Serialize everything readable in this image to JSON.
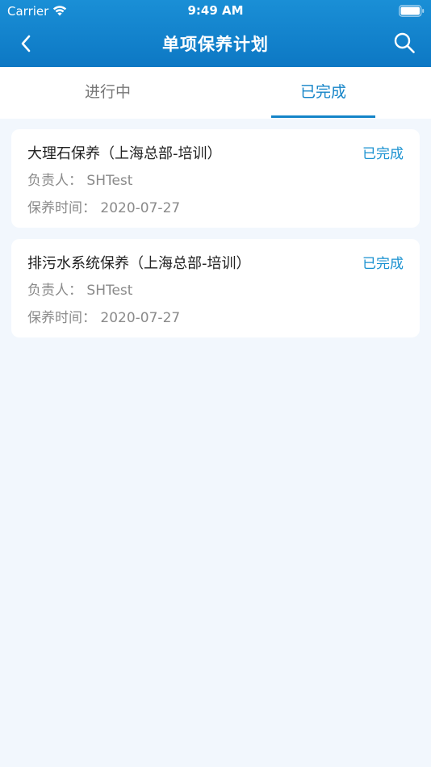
{
  "status_bar": {
    "carrier": "Carrier",
    "time": "9:49 AM",
    "wifi_icon": "wifi-icon",
    "battery_icon": "battery-icon"
  },
  "nav": {
    "title": "单项保养计划",
    "back_icon": "chevron-left-icon",
    "search_icon": "search-icon"
  },
  "tabs": [
    {
      "label": "进行中",
      "selected": false
    },
    {
      "label": "已完成",
      "selected": true
    }
  ],
  "cards": [
    {
      "title": "大理石保养（上海总部-培训）",
      "status": "已完成",
      "owner_label": "负责人：",
      "owner": "SHTest",
      "date_label": "保养时间：",
      "date": "2020-07-27"
    },
    {
      "title": "排污水系统保养（上海总部-培训）",
      "status": "已完成",
      "owner_label": "负责人：",
      "owner": "SHTest",
      "date_label": "保养时间：",
      "date": "2020-07-27"
    }
  ],
  "colors": {
    "header": "#1184cc",
    "accent": "#1484c8",
    "background": "#f2f7fd"
  }
}
